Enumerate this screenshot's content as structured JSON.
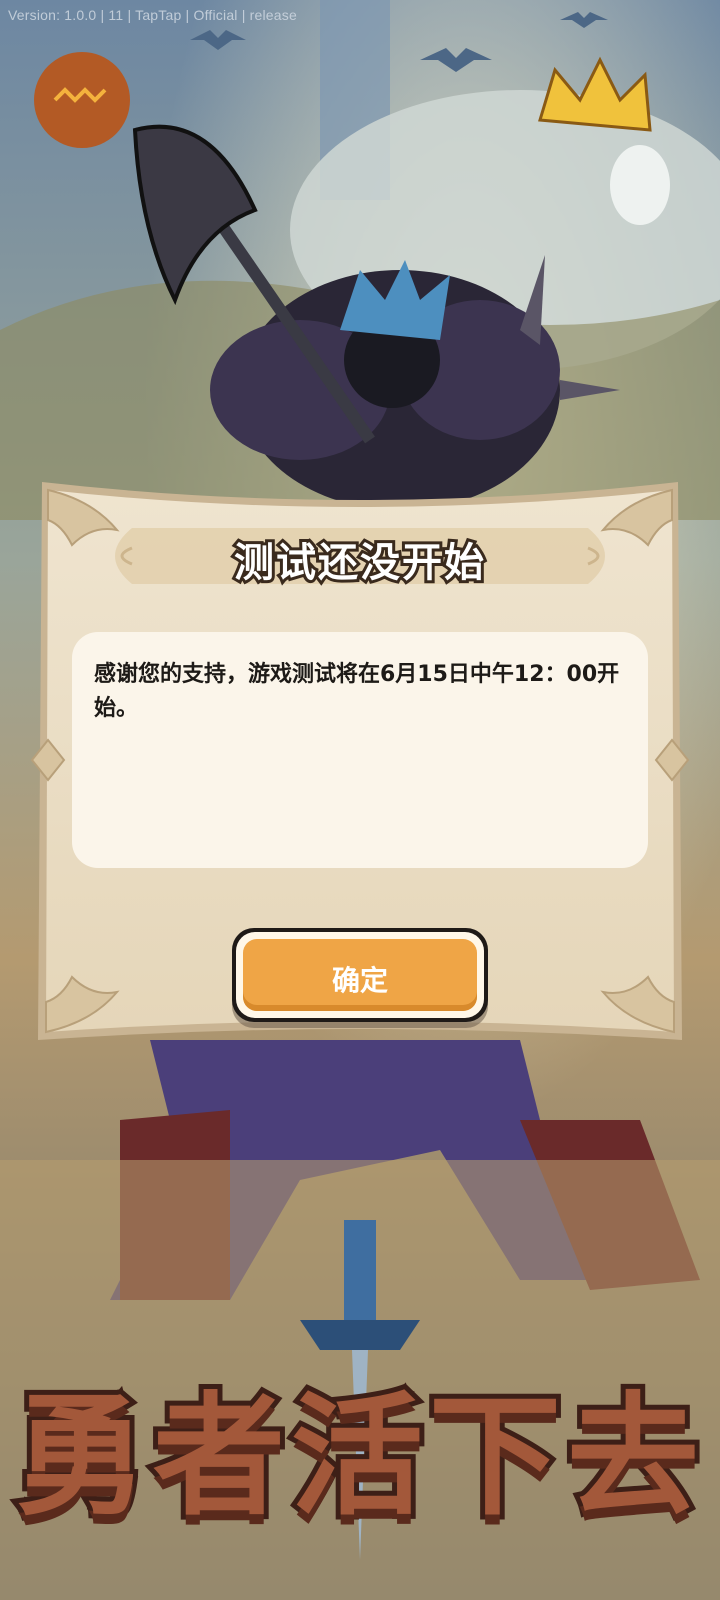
{
  "app": {
    "version": "Version: 1.0.0 | 11 | TapTap | Official | release"
  },
  "dialog": {
    "title": "测试还没开始",
    "message": "感谢您的支持，游戏测试将在6月15日中午12：00开始。",
    "confirm_label": "确定"
  },
  "game_logo": {
    "title": "勇者活下去"
  },
  "colors": {
    "panel": "#e9dcc3",
    "button": "#efa546",
    "message_box": "#fbf5ea",
    "title_stroke": "#3a2a1d"
  }
}
